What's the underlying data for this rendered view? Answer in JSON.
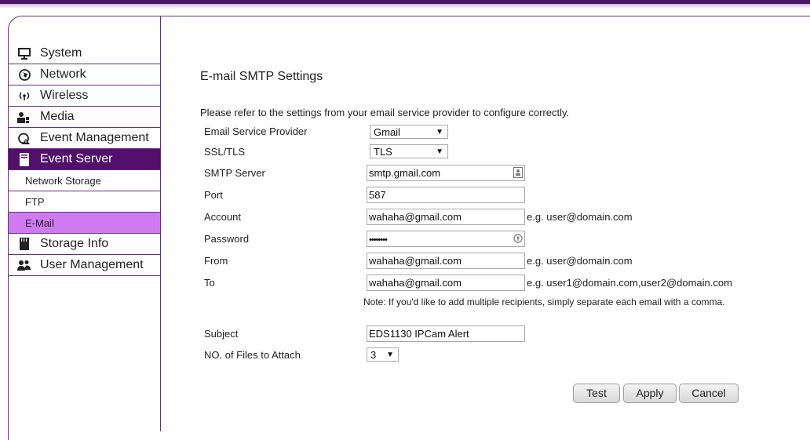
{
  "nav": {
    "system": "System",
    "network": "Network",
    "wireless": "Wireless",
    "media": "Media",
    "event_management": "Event Management",
    "event_server": "Event Server",
    "sub_network_storage": "Network Storage",
    "sub_ftp": "FTP",
    "sub_email": "E-Mail",
    "storage_info": "Storage Info",
    "user_management": "User Management"
  },
  "page": {
    "title": "E-mail SMTP Settings",
    "intro": "Please refer to the settings from your email service provider to configure correctly."
  },
  "form": {
    "provider_label": "Email Service Provider",
    "provider_value": "Gmail",
    "ssl_label": "SSL/TLS",
    "ssl_value": "TLS",
    "smtp_label": "SMTP Server",
    "smtp_value": "smtp.gmail.com",
    "port_label": "Port",
    "port_value": "587",
    "account_label": "Account",
    "account_value": "wahaha@gmail.com",
    "account_hint": "e.g. user@domain.com",
    "password_label": "Password",
    "password_value": "••••••••",
    "from_label": "From",
    "from_value": "wahaha@gmail.com",
    "from_hint": "e.g. user@domain.com",
    "to_label": "To",
    "to_value": "wahaha@gmail.com",
    "to_hint": "e.g. user1@domain.com,user2@domain.com",
    "note": "Note: If you'd like to add multiple recipients, simply separate each email with a comma.",
    "subject_label": "Subject",
    "subject_value": "EDS1130 IPCam Alert",
    "files_label": "NO. of Files to Attach",
    "files_value": "3"
  },
  "buttons": {
    "test": "Test",
    "apply": "Apply",
    "cancel": "Cancel"
  },
  "colors": {
    "accent": "#520f6c",
    "selected": "#cf7bf0",
    "border": "#6b2c84"
  }
}
